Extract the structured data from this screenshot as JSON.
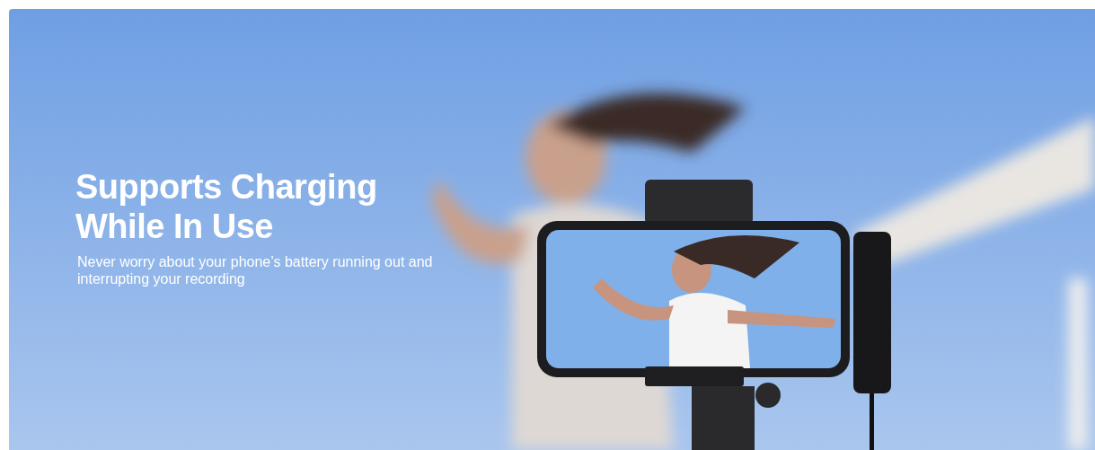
{
  "banner": {
    "heading": "Supports Charging While In Use",
    "description": "Never worry about your phone’s battery running out and interrupting your recording"
  }
}
